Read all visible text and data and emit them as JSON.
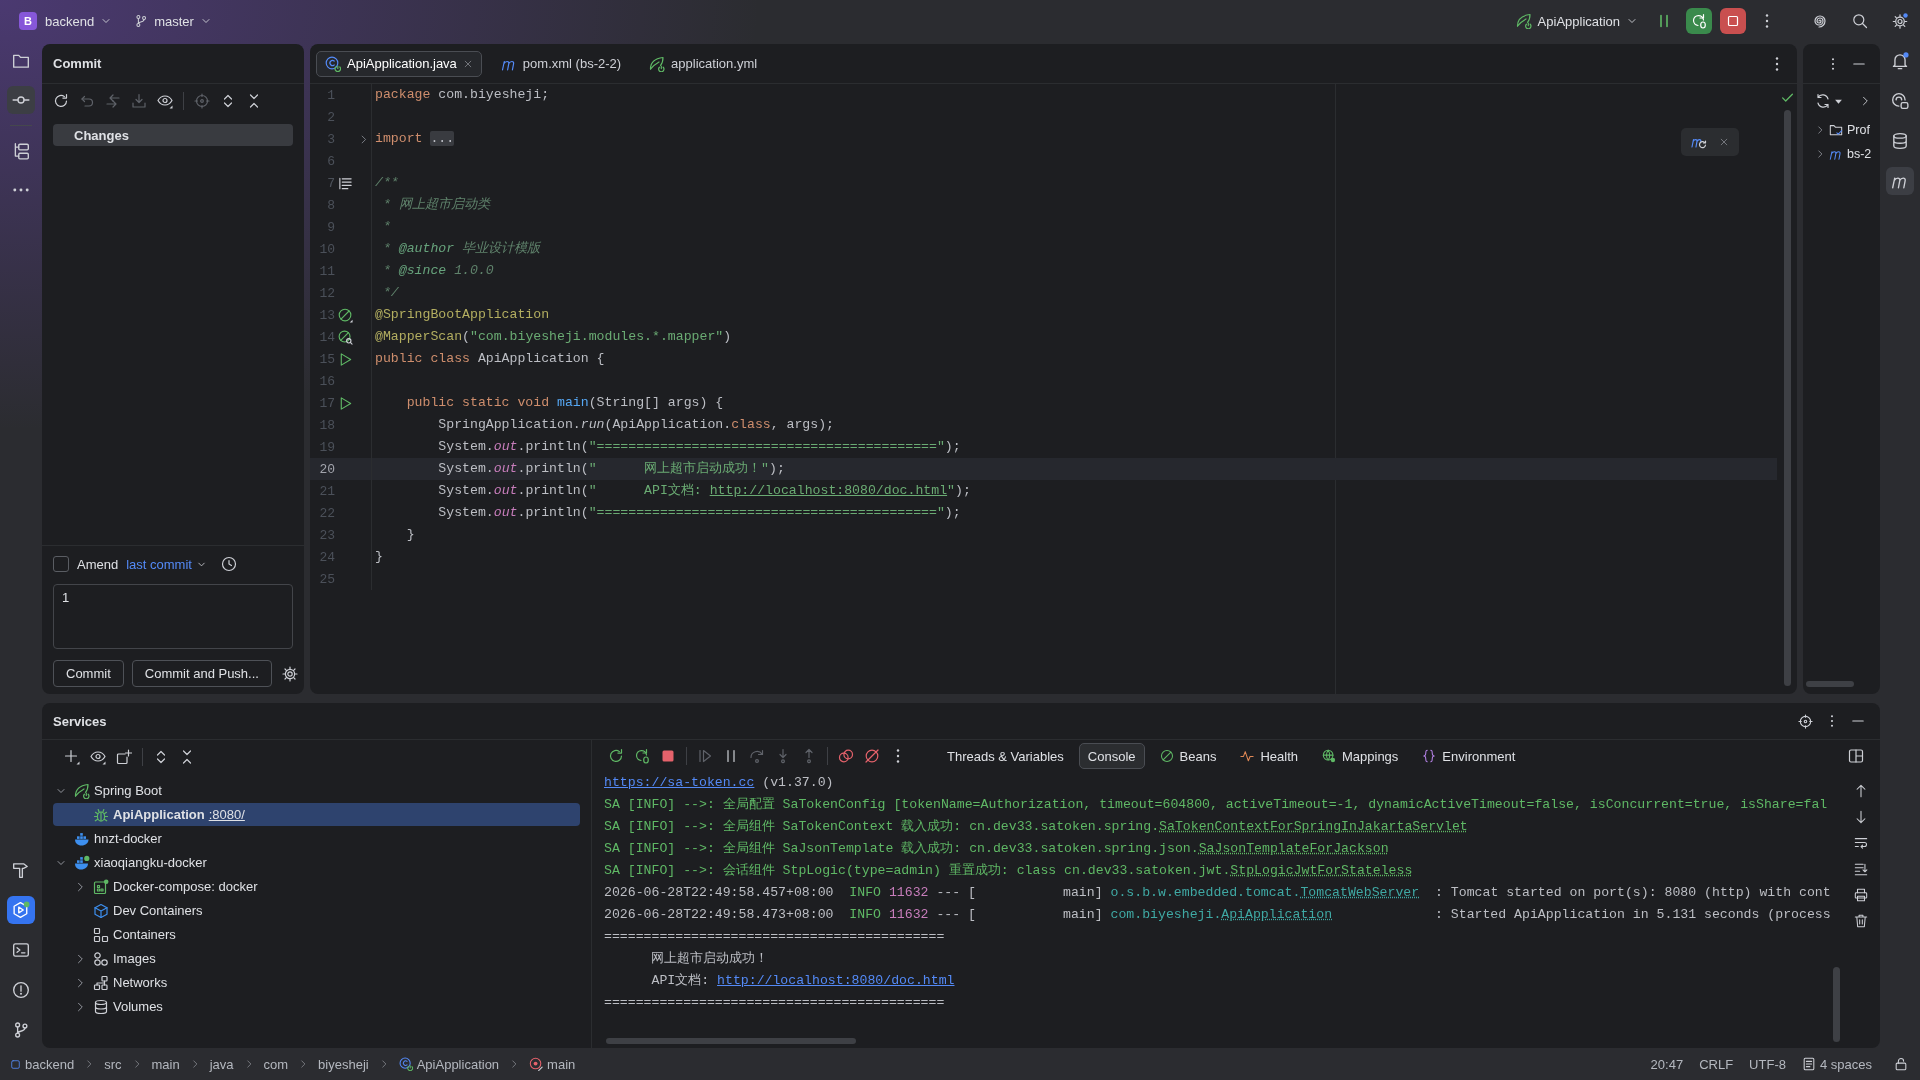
{
  "title_bar": {
    "project": {
      "badge": "B",
      "name": "backend"
    },
    "branch": "master",
    "run_config": "ApiApplication"
  },
  "left_toolbar": {
    "top": [
      {
        "items": [
          {
            "kind": "project",
            "selected": false,
            "focused": false
          },
          {
            "kind": "commit",
            "selected": true,
            "focused": false
          }
        ]
      },
      {
        "items": [
          {
            "kind": "structure",
            "selected": false,
            "focused": false
          },
          {
            "kind": "more",
            "selected": false,
            "focused": false
          }
        ]
      }
    ],
    "bottom": [
      {
        "kind": "build",
        "selected": false,
        "focused": false
      },
      {
        "kind": "services",
        "selected": true,
        "focused": true
      },
      {
        "kind": "terminal",
        "selected": false,
        "focused": false
      },
      {
        "kind": "problems",
        "selected": false,
        "focused": false
      },
      {
        "kind": "git",
        "selected": false,
        "focused": false
      }
    ]
  },
  "right_toolbar": [
    {
      "kind": "notifications",
      "selected": false
    },
    {
      "kind": "ai-chat",
      "selected": false
    },
    {
      "kind": "database",
      "selected": false
    },
    {
      "kind": "maven",
      "selected": true
    }
  ],
  "commit_panel": {
    "title": "Commit",
    "changes": {
      "label": "Changes",
      "selected": true
    },
    "amend": {
      "label": "Amend",
      "checked": false,
      "link": "last commit"
    },
    "message": "1",
    "buttons": [
      "Commit",
      "Commit and Push..."
    ]
  },
  "editor": {
    "tabs": [
      {
        "label": "ApiApplication.java",
        "kind": "java",
        "selected": true
      },
      {
        "label": "pom.xml (bs-2-2)",
        "kind": "maven",
        "selected": false
      },
      {
        "label": "application.yml",
        "kind": "spring",
        "selected": false
      }
    ],
    "lines": [
      {
        "number": "1",
        "kind": "plain",
        "current": false,
        "tokens": [
          {
            "kind": "keyword",
            "text": "package"
          },
          {
            "kind": "plain",
            "text": " com.biyesheji;"
          }
        ]
      },
      {
        "number": "2",
        "kind": "plain",
        "current": false
      },
      {
        "number": "3",
        "kind": "fold",
        "current": false,
        "tokens": [
          {
            "kind": "keyword",
            "text": "import "
          },
          {
            "kind": "folded",
            "text": "..."
          }
        ]
      },
      {
        "number": "6",
        "kind": "plain",
        "current": false
      },
      {
        "number": "7",
        "kind": "doc",
        "current": false,
        "tokens": [
          {
            "kind": "doc",
            "text": "/**"
          }
        ]
      },
      {
        "number": "8",
        "kind": "plain",
        "current": false,
        "tokens": [
          {
            "kind": "doc",
            "text": " * 网上超市启动类"
          }
        ]
      },
      {
        "number": "9",
        "kind": "plain",
        "current": false,
        "tokens": [
          {
            "kind": "doc",
            "text": " *"
          }
        ]
      },
      {
        "number": "10",
        "kind": "plain",
        "current": false,
        "tokens": [
          {
            "kind": "doc",
            "text": " * "
          },
          {
            "kind": "doc-tag",
            "text": "@author"
          },
          {
            "kind": "doc",
            "text": " 毕业设计模版"
          }
        ]
      },
      {
        "number": "11",
        "kind": "plain",
        "current": false,
        "tokens": [
          {
            "kind": "doc",
            "text": " * "
          },
          {
            "kind": "doc-tag",
            "text": "@since"
          },
          {
            "kind": "doc",
            "text": " 1.0.0"
          }
        ]
      },
      {
        "number": "12",
        "kind": "plain",
        "current": false,
        "tokens": [
          {
            "kind": "doc",
            "text": " */"
          }
        ]
      },
      {
        "number": "13",
        "kind": "bean",
        "current": false,
        "tokens": [
          {
            "kind": "annotation",
            "text": "@SpringBootApplication"
          }
        ]
      },
      {
        "number": "14",
        "kind": "mapper",
        "current": false,
        "tokens": [
          {
            "kind": "annotation",
            "text": "@MapperScan"
          },
          {
            "kind": "plain",
            "text": "("
          },
          {
            "kind": "string",
            "text": "\"com.biyesheji.modules.*.mapper\""
          },
          {
            "kind": "plain",
            "text": ")"
          }
        ]
      },
      {
        "number": "15",
        "kind": "run",
        "current": false,
        "tokens": [
          {
            "kind": "keyword",
            "text": "public class"
          },
          {
            "kind": "plain",
            "text": " ApiApplication {"
          }
        ]
      },
      {
        "number": "16",
        "kind": "plain",
        "current": false
      },
      {
        "number": "17",
        "kind": "run",
        "current": false,
        "tokens": [
          {
            "kind": "keyword",
            "text": "    public static void "
          },
          {
            "kind": "method",
            "text": "main"
          },
          {
            "kind": "plain",
            "text": "(String[] args) {"
          }
        ]
      },
      {
        "number": "18",
        "kind": "plain",
        "current": false,
        "tokens": [
          {
            "kind": "plain",
            "text": "        SpringApplication."
          },
          {
            "kind": "static-call",
            "text": "run"
          },
          {
            "kind": "plain",
            "text": "(ApiApplication."
          },
          {
            "kind": "keyword",
            "text": "class"
          },
          {
            "kind": "plain",
            "text": ", args);"
          }
        ]
      },
      {
        "number": "19",
        "kind": "plain",
        "current": false,
        "tokens": [
          {
            "kind": "plain",
            "text": "        System."
          },
          {
            "kind": "static-field",
            "text": "out"
          },
          {
            "kind": "plain",
            "text": ".println("
          },
          {
            "kind": "string",
            "text": "\"===========================================\""
          },
          {
            "kind": "plain",
            "text": ");"
          }
        ]
      },
      {
        "number": "20",
        "kind": "plain",
        "current": true,
        "tokens": [
          {
            "kind": "plain",
            "text": "        System."
          },
          {
            "kind": "static-field",
            "text": "out"
          },
          {
            "kind": "plain",
            "text": ".println("
          },
          {
            "kind": "string",
            "text": "\"      网上超市启动成功！\""
          },
          {
            "kind": "plain",
            "text": ");"
          }
        ]
      },
      {
        "number": "21",
        "kind": "plain",
        "current": false,
        "tokens": [
          {
            "kind": "plain",
            "text": "        System."
          },
          {
            "kind": "static-field",
            "text": "out"
          },
          {
            "kind": "plain",
            "text": ".println("
          },
          {
            "kind": "string",
            "text": "\"      API文档: "
          },
          {
            "kind": "link",
            "text": "http://localhost:8080/doc.html"
          },
          {
            "kind": "string",
            "text": "\""
          },
          {
            "kind": "plain",
            "text": ");"
          }
        ]
      },
      {
        "number": "22",
        "kind": "plain",
        "current": false,
        "tokens": [
          {
            "kind": "plain",
            "text": "        System."
          },
          {
            "kind": "static-field",
            "text": "out"
          },
          {
            "kind": "plain",
            "text": ".println("
          },
          {
            "kind": "string",
            "text": "\"===========================================\""
          },
          {
            "kind": "plain",
            "text": ");"
          }
        ]
      },
      {
        "number": "23",
        "kind": "plain",
        "current": false,
        "tokens": [
          {
            "kind": "plain",
            "text": "    }"
          }
        ]
      },
      {
        "number": "24",
        "kind": "plain",
        "current": false,
        "tokens": [
          {
            "kind": "plain",
            "text": "}"
          }
        ]
      },
      {
        "number": "25",
        "kind": "plain",
        "current": false
      }
    ]
  },
  "maven_panel": {
    "items": [
      {
        "label": "Prof",
        "kind": "profiles",
        "expanded": false
      },
      {
        "label": "bs-2",
        "kind": "module",
        "expanded": false
      }
    ]
  },
  "services": {
    "title": "Services",
    "tree": [
      {
        "label": "Spring Boot",
        "kind": "spring",
        "expanded": true,
        "selected": false,
        "children": [
          {
            "label": "ApiApplication",
            "link": ":8080/",
            "kind": "app",
            "selected": true
          }
        ]
      },
      {
        "label": "hnzt-docker",
        "kind": "docker",
        "selected": false
      },
      {
        "label": "xiaoqiangku-docker",
        "kind": "docker-connected",
        "expanded": true,
        "selected": false,
        "children": [
          {
            "label": "Docker-compose: docker",
            "kind": "compose",
            "expanded": false,
            "selected": false
          },
          {
            "label": "Dev Containers",
            "kind": "dev-containers",
            "selected": false
          },
          {
            "label": "Containers",
            "kind": "containers",
            "selected": false
          },
          {
            "label": "Images",
            "kind": "images",
            "expanded": false,
            "selected": false
          },
          {
            "label": "Networks",
            "kind": "networks",
            "expanded": false,
            "selected": false
          },
          {
            "label": "Volumes",
            "kind": "volumes",
            "expanded": false,
            "selected": false
          }
        ]
      }
    ],
    "console": {
      "tabs": [
        {
          "label": "Threads & Variables",
          "kind": "plain",
          "selected": false
        },
        {
          "label": "Console",
          "kind": "plain",
          "selected": true
        },
        {
          "label": "Beans",
          "kind": "beans",
          "selected": false
        },
        {
          "label": "Health",
          "kind": "health",
          "selected": false
        },
        {
          "label": "Mappings",
          "kind": "mappings",
          "selected": false
        },
        {
          "label": "Environment",
          "kind": "environment",
          "selected": false
        }
      ],
      "lines": [
        {
          "tokens": [
            {
              "kind": "link",
              "text": "https://sa-token.cc"
            },
            {
              "kind": "text",
              "text": " (v1.37.0)"
            }
          ]
        },
        {
          "tokens": [
            {
              "kind": "info",
              "text": "SA [INFO] -->: 全局配置 SaTokenConfig [tokenName=Authorization, timeout=604800, activeTimeout=-1, dynamicActiveTimeout=false, isConcurrent=true, isShare=fal"
            }
          ]
        },
        {
          "tokens": [
            {
              "kind": "info",
              "text": "SA [INFO] -->: 全局组件 SaTokenContext 载入成功: cn.dev33.satoken.spring."
            },
            {
              "kind": "class-link",
              "text": "SaTokenContextForSpringInJakartaServlet"
            }
          ]
        },
        {
          "tokens": [
            {
              "kind": "info",
              "text": "SA [INFO] -->: 全局组件 SaJsonTemplate 载入成功: cn.dev33.satoken.spring.json."
            },
            {
              "kind": "class-link",
              "text": "SaJsonTemplateForJackson"
            }
          ]
        },
        {
          "tokens": [
            {
              "kind": "info",
              "text": "SA [INFO] -->: 会话组件 StpLogic(type=admin) 重置成功: class cn.dev33.satoken.jwt."
            },
            {
              "kind": "class-link",
              "text": "StpLogicJwtForStateless"
            }
          ]
        },
        {
          "tokens": [
            {
              "kind": "text",
              "text": "2026-06-28T22:49:58.457+08:00  "
            },
            {
              "kind": "info",
              "text": "INFO"
            },
            {
              "kind": "pid",
              "text": " 11632"
            },
            {
              "kind": "text",
              "text": " --- [           main] "
            },
            {
              "kind": "logger",
              "text": "o.s.b.w.embedded.tomcat."
            },
            {
              "kind": "logger-link",
              "text": "TomcatWebServer"
            },
            {
              "kind": "text",
              "text": "  : Tomcat started on port(s): 8080 (http) with cont"
            }
          ]
        },
        {
          "tokens": [
            {
              "kind": "text",
              "text": "2026-06-28T22:49:58.473+08:00  "
            },
            {
              "kind": "info",
              "text": "INFO"
            },
            {
              "kind": "pid",
              "text": " 11632"
            },
            {
              "kind": "text",
              "text": " --- [           main] "
            },
            {
              "kind": "logger",
              "text": "com.biyesheji."
            },
            {
              "kind": "logger-link",
              "text": "ApiApplication"
            },
            {
              "kind": "text",
              "text": "             : Started ApiApplication in 5.131 seconds (process"
            }
          ]
        },
        {
          "tokens": [
            {
              "kind": "text",
              "text": "==========================================="
            }
          ]
        },
        {
          "tokens": [
            {
              "kind": "text",
              "text": "      网上超市启动成功！"
            }
          ]
        },
        {
          "tokens": [
            {
              "kind": "text",
              "text": "      API文档: "
            },
            {
              "kind": "link",
              "text": "http://localhost:8080/doc.html"
            }
          ]
        },
        {
          "tokens": [
            {
              "kind": "text",
              "text": "==========================================="
            }
          ]
        }
      ]
    }
  },
  "status_bar": {
    "breadcrumbs": [
      {
        "label": "backend",
        "kind": "module"
      },
      {
        "label": "src",
        "kind": "plain"
      },
      {
        "label": "main",
        "kind": "plain"
      },
      {
        "label": "java",
        "kind": "plain"
      },
      {
        "label": "com",
        "kind": "plain"
      },
      {
        "label": "biyesheji",
        "kind": "plain"
      },
      {
        "label": "ApiApplication",
        "kind": "class"
      },
      {
        "label": "main",
        "kind": "method"
      }
    ],
    "position": "20:47",
    "line_separator": "CRLF",
    "encoding": "UTF-8",
    "indent": "4 spaces"
  }
}
